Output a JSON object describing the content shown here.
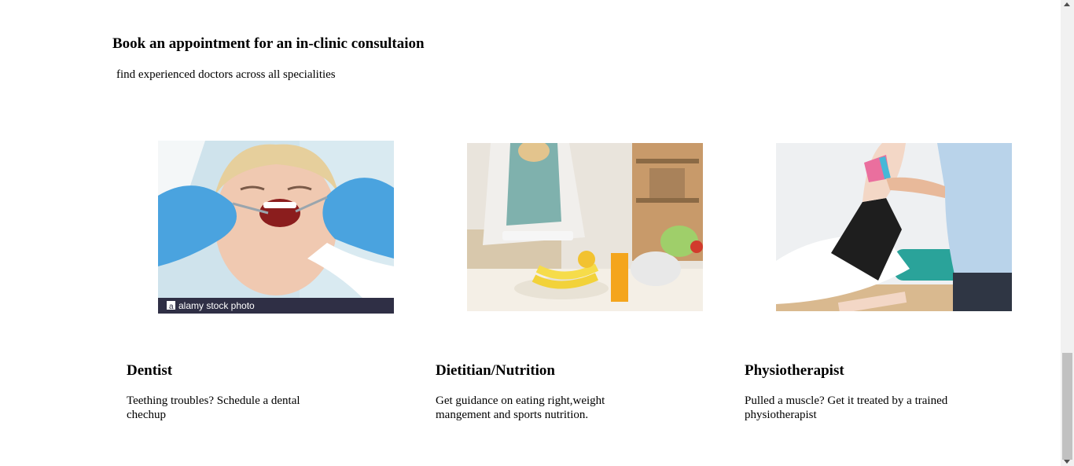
{
  "section": {
    "heading": "Book an appointment for an in-clinic consultaion",
    "subheading": "find experienced doctors across all specialities"
  },
  "cards": [
    {
      "image_label": "dentist-photo",
      "watermark": "alamy stock photo",
      "title": "Dentist",
      "description": "Teething troubles? Schedule a dental chechup"
    },
    {
      "image_label": "dietitian-photo",
      "title": "Dietitian/Nutrition",
      "description": "Get guidance on eating right,weight mangement and sports nutrition."
    },
    {
      "image_label": "physiotherapist-photo",
      "title": "Physiotherapist",
      "description": "Pulled a muscle? Get it treated by a trained physiotherapist"
    }
  ],
  "colors": {
    "background": "#ffffff",
    "glove_blue": "#4aa3df",
    "scrollbar_track": "#f1f1f1",
    "scrollbar_thumb": "#c1c1c1"
  }
}
